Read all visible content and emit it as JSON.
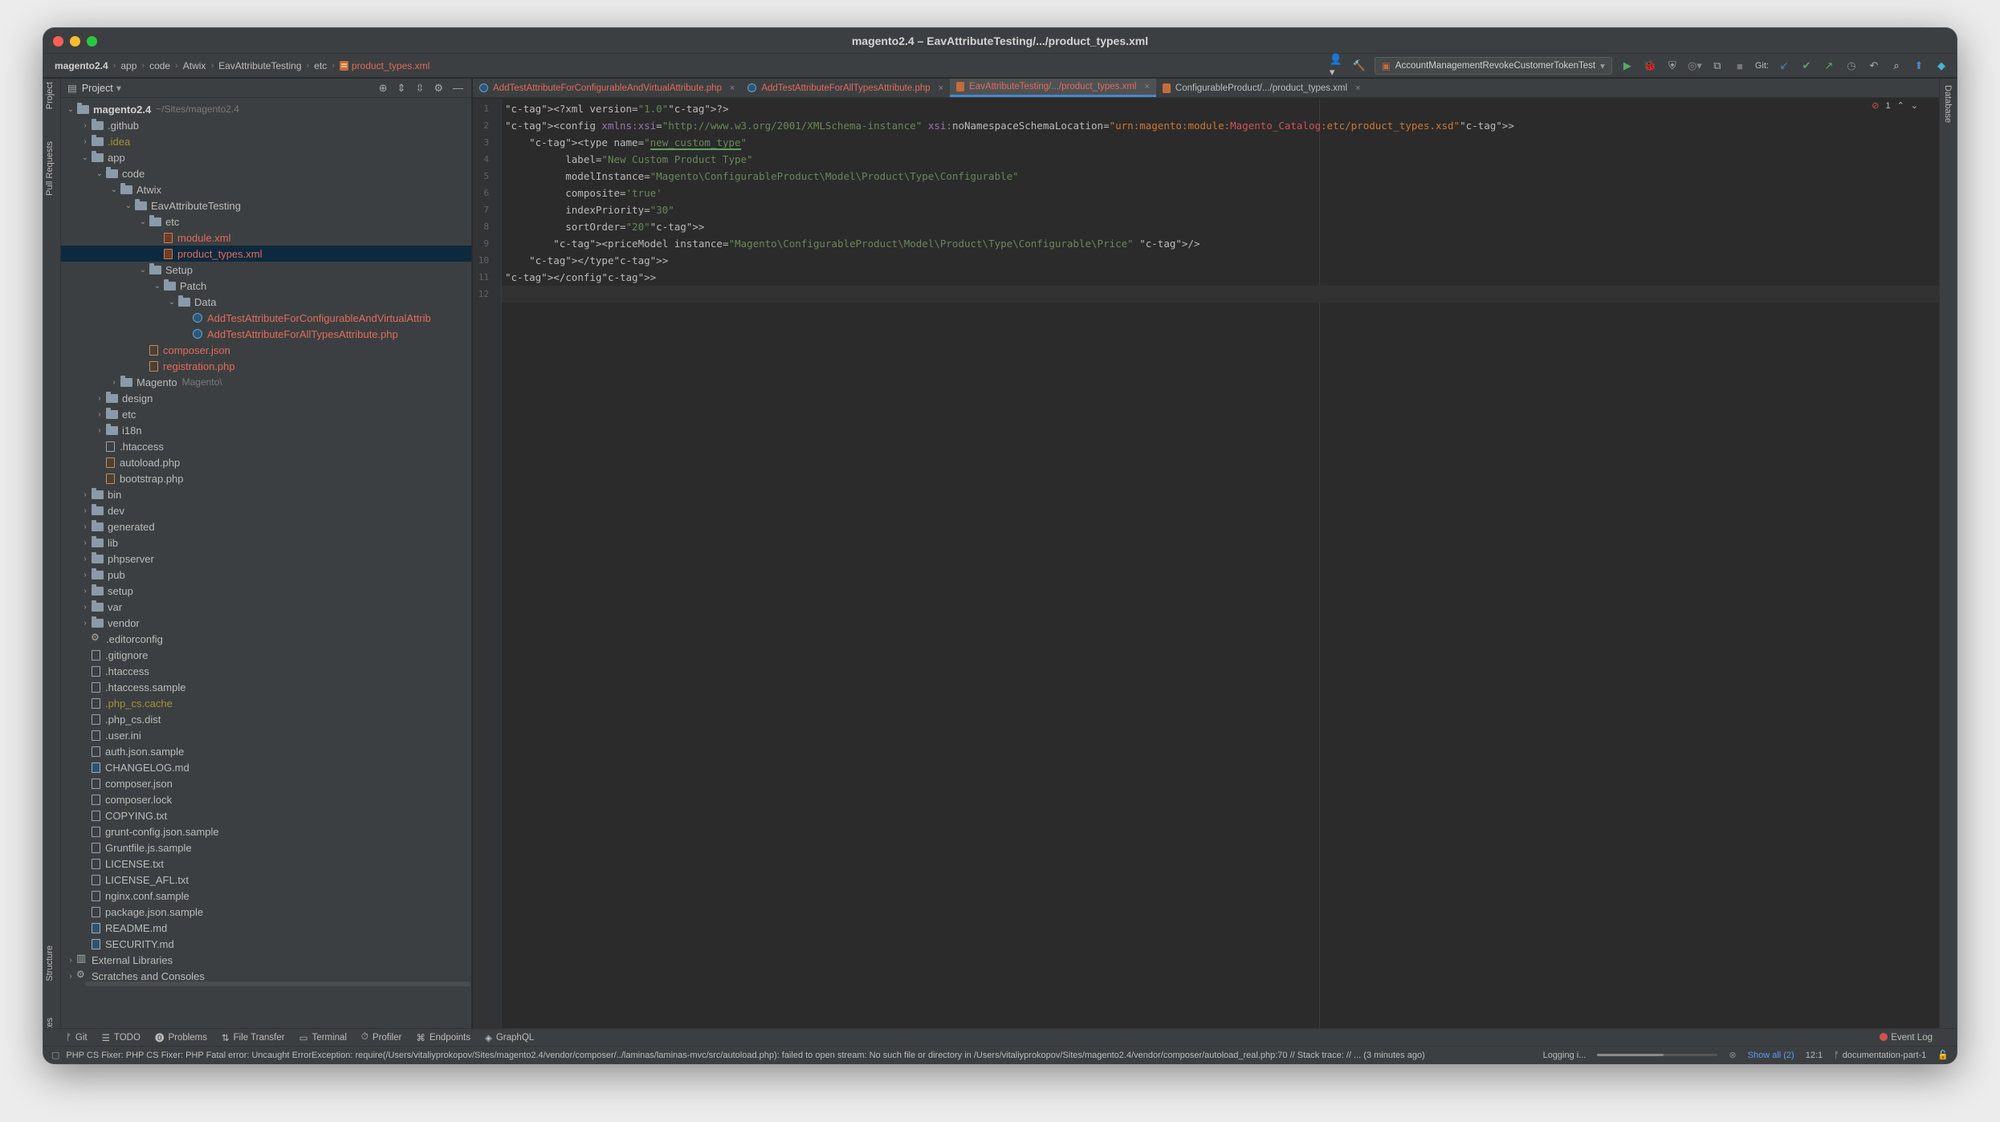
{
  "window": {
    "title": "magento2.4 – EavAttributeTesting/.../product_types.xml"
  },
  "breadcrumb": [
    "magento2.4",
    "app",
    "code",
    "Atwix",
    "EavAttributeTesting",
    "etc",
    "product_types.xml"
  ],
  "toolbar": {
    "run_config": "AccountManagementRevokeCustomerTokenTest",
    "git_label": "Git:"
  },
  "left_strip": {
    "project": "Project",
    "pull_requests": "Pull Requests",
    "structure": "Structure",
    "favorites": "Favorites"
  },
  "right_strip": {
    "database": "Database"
  },
  "project_panel": {
    "header": "Project",
    "tree": [
      {
        "depth": 0,
        "label": "magento2.4",
        "hint": "~/Sites/magento2.4",
        "type": "folder",
        "expanded": true,
        "style": "bold"
      },
      {
        "depth": 1,
        "label": ".github",
        "type": "folder",
        "expanded": false
      },
      {
        "depth": 1,
        "label": ".idea",
        "type": "folder",
        "expanded": false,
        "style": "olive"
      },
      {
        "depth": 1,
        "label": "app",
        "type": "folder",
        "expanded": true
      },
      {
        "depth": 2,
        "label": "code",
        "type": "folder",
        "expanded": true
      },
      {
        "depth": 3,
        "label": "Atwix",
        "type": "folder",
        "expanded": true
      },
      {
        "depth": 4,
        "label": "EavAttributeTesting",
        "type": "folder",
        "expanded": true
      },
      {
        "depth": 5,
        "label": "etc",
        "type": "folder",
        "expanded": true
      },
      {
        "depth": 6,
        "label": "module.xml",
        "type": "xml",
        "style": "red"
      },
      {
        "depth": 6,
        "label": "product_types.xml",
        "type": "xml",
        "style": "red",
        "selected": true
      },
      {
        "depth": 5,
        "label": "Setup",
        "type": "folder",
        "expanded": true
      },
      {
        "depth": 6,
        "label": "Patch",
        "type": "folder",
        "expanded": true
      },
      {
        "depth": 7,
        "label": "Data",
        "type": "folder",
        "expanded": true
      },
      {
        "depth": 8,
        "label": "AddTestAttributeForConfigurableAndVirtualAttrib",
        "type": "php",
        "style": "red"
      },
      {
        "depth": 8,
        "label": "AddTestAttributeForAllTypesAttribute.php",
        "type": "php",
        "style": "red"
      },
      {
        "depth": 5,
        "label": "composer.json",
        "type": "json",
        "style": "red"
      },
      {
        "depth": 5,
        "label": "registration.php",
        "type": "json",
        "style": "red"
      },
      {
        "depth": 3,
        "label": "Magento",
        "hint": "Magento\\",
        "type": "folder",
        "expanded": false
      },
      {
        "depth": 2,
        "label": "design",
        "type": "folder",
        "expanded": false
      },
      {
        "depth": 2,
        "label": "etc",
        "type": "folder",
        "expanded": false
      },
      {
        "depth": 2,
        "label": "i18n",
        "type": "folder",
        "expanded": false
      },
      {
        "depth": 2,
        "label": ".htaccess",
        "type": "file"
      },
      {
        "depth": 2,
        "label": "autoload.php",
        "type": "json"
      },
      {
        "depth": 2,
        "label": "bootstrap.php",
        "type": "json"
      },
      {
        "depth": 1,
        "label": "bin",
        "type": "folder",
        "expanded": false
      },
      {
        "depth": 1,
        "label": "dev",
        "type": "folder",
        "expanded": false
      },
      {
        "depth": 1,
        "label": "generated",
        "type": "folder",
        "expanded": false
      },
      {
        "depth": 1,
        "label": "lib",
        "type": "folder",
        "expanded": false
      },
      {
        "depth": 1,
        "label": "phpserver",
        "type": "folder",
        "expanded": false
      },
      {
        "depth": 1,
        "label": "pub",
        "type": "folder",
        "expanded": false
      },
      {
        "depth": 1,
        "label": "setup",
        "type": "folder",
        "expanded": false
      },
      {
        "depth": 1,
        "label": "var",
        "type": "folder",
        "expanded": false
      },
      {
        "depth": 1,
        "label": "vendor",
        "type": "folder",
        "expanded": false
      },
      {
        "depth": 1,
        "label": ".editorconfig",
        "type": "gear"
      },
      {
        "depth": 1,
        "label": ".gitignore",
        "type": "file"
      },
      {
        "depth": 1,
        "label": ".htaccess",
        "type": "file"
      },
      {
        "depth": 1,
        "label": ".htaccess.sample",
        "type": "file"
      },
      {
        "depth": 1,
        "label": ".php_cs.cache",
        "type": "file",
        "style": "olive"
      },
      {
        "depth": 1,
        "label": ".php_cs.dist",
        "type": "file"
      },
      {
        "depth": 1,
        "label": ".user.ini",
        "type": "file"
      },
      {
        "depth": 1,
        "label": "auth.json.sample",
        "type": "file"
      },
      {
        "depth": 1,
        "label": "CHANGELOG.md",
        "type": "md"
      },
      {
        "depth": 1,
        "label": "composer.json",
        "type": "file"
      },
      {
        "depth": 1,
        "label": "composer.lock",
        "type": "file"
      },
      {
        "depth": 1,
        "label": "COPYING.txt",
        "type": "file"
      },
      {
        "depth": 1,
        "label": "grunt-config.json.sample",
        "type": "file"
      },
      {
        "depth": 1,
        "label": "Gruntfile.js.sample",
        "type": "file"
      },
      {
        "depth": 1,
        "label": "LICENSE.txt",
        "type": "file"
      },
      {
        "depth": 1,
        "label": "LICENSE_AFL.txt",
        "type": "file"
      },
      {
        "depth": 1,
        "label": "nginx.conf.sample",
        "type": "file"
      },
      {
        "depth": 1,
        "label": "package.json.sample",
        "type": "file"
      },
      {
        "depth": 1,
        "label": "README.md",
        "type": "md"
      },
      {
        "depth": 1,
        "label": "SECURITY.md",
        "type": "md"
      },
      {
        "depth": 0,
        "label": "External Libraries",
        "type": "lib",
        "expanded": false
      },
      {
        "depth": 0,
        "label": "Scratches and Consoles",
        "type": "gear",
        "expanded": false
      }
    ]
  },
  "editor_tabs": [
    {
      "label": "AddTestAttributeForConfigurableAndVirtualAttribute.php",
      "icon": "php",
      "active": false
    },
    {
      "label": "AddTestAttributeForAllTypesAttribute.php",
      "icon": "php",
      "active": false
    },
    {
      "label": "EavAttributeTesting/.../product_types.xml",
      "icon": "xml",
      "active": true
    },
    {
      "label": "ConfigurableProduct/.../product_types.xml",
      "icon": "xml",
      "active": false,
      "plain": true
    }
  ],
  "editor": {
    "error_count": "1",
    "lines": [
      "<?xml version=\"1.0\"?>",
      "<config xmlns:xsi=\"http://www.w3.org/2001/XMLSchema-instance\" xsi:noNamespaceSchemaLocation=\"urn:magento:module:Magento_Catalog:etc/product_types.xsd\">",
      "    <type name=\"new_custom_type\"",
      "          label=\"New Custom Product Type\"",
      "          modelInstance=\"Magento\\ConfigurableProduct\\Model\\Product\\Type\\Configurable\"",
      "          composite='true'",
      "          indexPriority=\"30\"",
      "          sortOrder=\"20\">",
      "        <priceModel instance=\"Magento\\ConfigurableProduct\\Model\\Product\\Type\\Configurable\\Price\" />",
      "    </type>",
      "</config>",
      ""
    ]
  },
  "tool_windows": [
    "Git",
    "TODO",
    "Problems",
    "File Transfer",
    "Terminal",
    "Profiler",
    "Endpoints",
    "GraphQL"
  ],
  "event_log": "Event Log",
  "status": {
    "message": "PHP CS Fixer: PHP CS Fixer: PHP Fatal error:  Uncaught ErrorException: require(/Users/vitaliyprokopov/Sites/magento2.4/vendor/composer/../laminas/laminas-mvc/src/autoload.php): failed to open stream: No such file or directory in /Users/vitaliyprokopov/Sites/magento2.4/vendor/composer/autoload_real.php:70 // Stack trace: // ... (3 minutes ago)",
    "logging": "Logging i...",
    "progress": 0.55,
    "show_all": "Show all (2)",
    "cursor": "12:1",
    "branch": "documentation-part-1"
  }
}
